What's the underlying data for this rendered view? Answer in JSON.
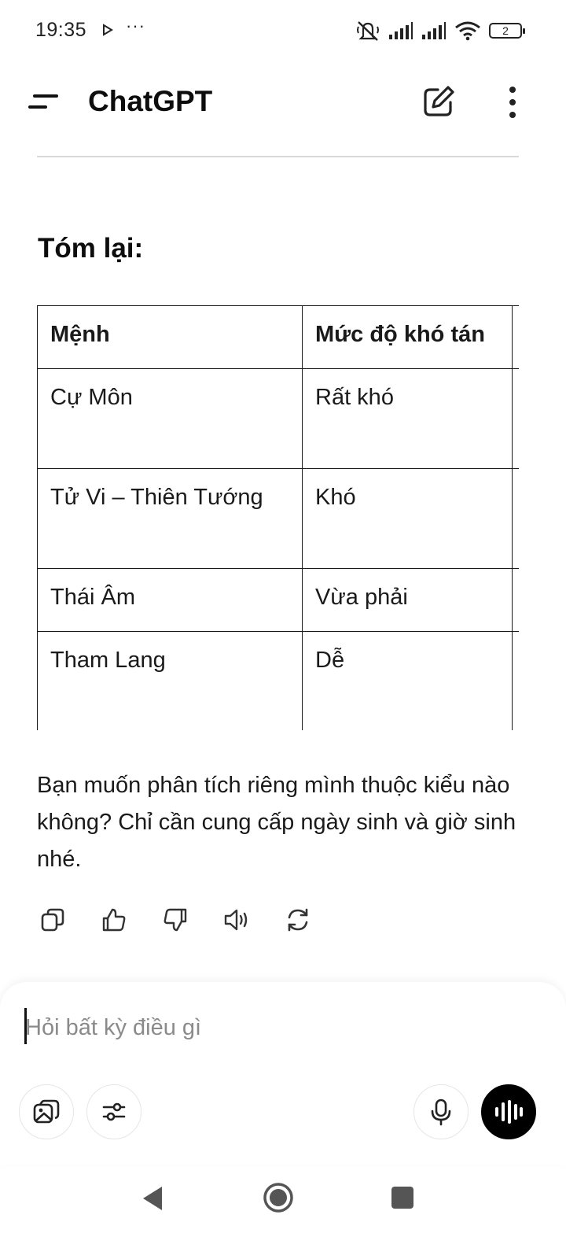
{
  "status_bar": {
    "time": "19:35",
    "overflow": "···",
    "battery": "2",
    "icons": [
      "media-play-icon",
      "mute-icon",
      "signal-icon",
      "signal-icon",
      "wifi-icon",
      "battery-icon"
    ]
  },
  "header": {
    "title": "ChatGPT",
    "icons": [
      "menu-icon",
      "new-chat-icon",
      "more-vertical-icon"
    ]
  },
  "content": {
    "heading": "Tóm lại:",
    "table": {
      "headers": [
        "Mệnh",
        "Mức độ khó tán"
      ],
      "rows": [
        [
          "Cự Môn",
          "Rất khó"
        ],
        [
          "Tử Vi – Thiên Tướng",
          "Khó"
        ],
        [
          "Thái Âm",
          "Vừa phải"
        ],
        [
          "Tham Lang",
          "Dễ"
        ]
      ]
    },
    "followup": "Bạn muốn phân tích riêng mình thuộc kiểu nào không? Chỉ cần cung cấp ngày sinh và giờ sinh nhé.",
    "actions": [
      "copy-icon",
      "thumbs-up-icon",
      "thumbs-down-icon",
      "speaker-icon",
      "regenerate-icon"
    ]
  },
  "composer": {
    "placeholder": "Hỏi bất kỳ điều gì",
    "value": "",
    "buttons": [
      "attach-image-icon",
      "tools-icon",
      "microphone-icon",
      "voice-mode-icon"
    ]
  },
  "nav_bar": {
    "buttons": [
      "back-icon",
      "home-icon",
      "recents-icon"
    ]
  }
}
